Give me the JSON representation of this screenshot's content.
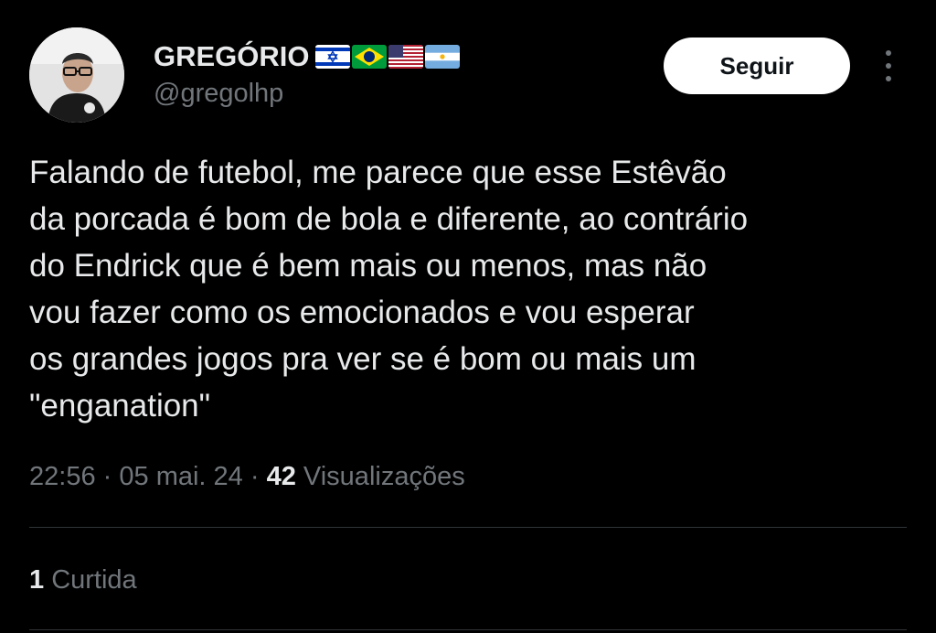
{
  "tweet": {
    "author_name": "GREGÓRIO",
    "author_handle": "@gregolhp",
    "flags": [
      "israel-flag-icon",
      "brazil-flag-icon",
      "usa-flag-icon",
      "argentina-flag-icon"
    ],
    "follow_label": "Seguir",
    "text_lines": [
      "Falando de futebol, me parece que esse Estêvão",
      "da porcada é bom de bola e diferente, ao contrário",
      "do Endrick que é bem mais ou menos, mas não",
      "vou fazer como os emocionados e vou esperar",
      "os grandes jogos pra ver se é bom ou mais um",
      "\"enganation\""
    ],
    "time": "22:56",
    "date": "05 mai. 24",
    "separator": "·",
    "views_count": "42",
    "views_label": "Visualizações",
    "likes_count": "1",
    "likes_label": "Curtida"
  },
  "colors": {
    "background": "#000000",
    "primary_text": "#e7e9ea",
    "secondary_text": "#71767b",
    "divider": "#2f3336",
    "follow_button_bg": "#ffffff"
  }
}
